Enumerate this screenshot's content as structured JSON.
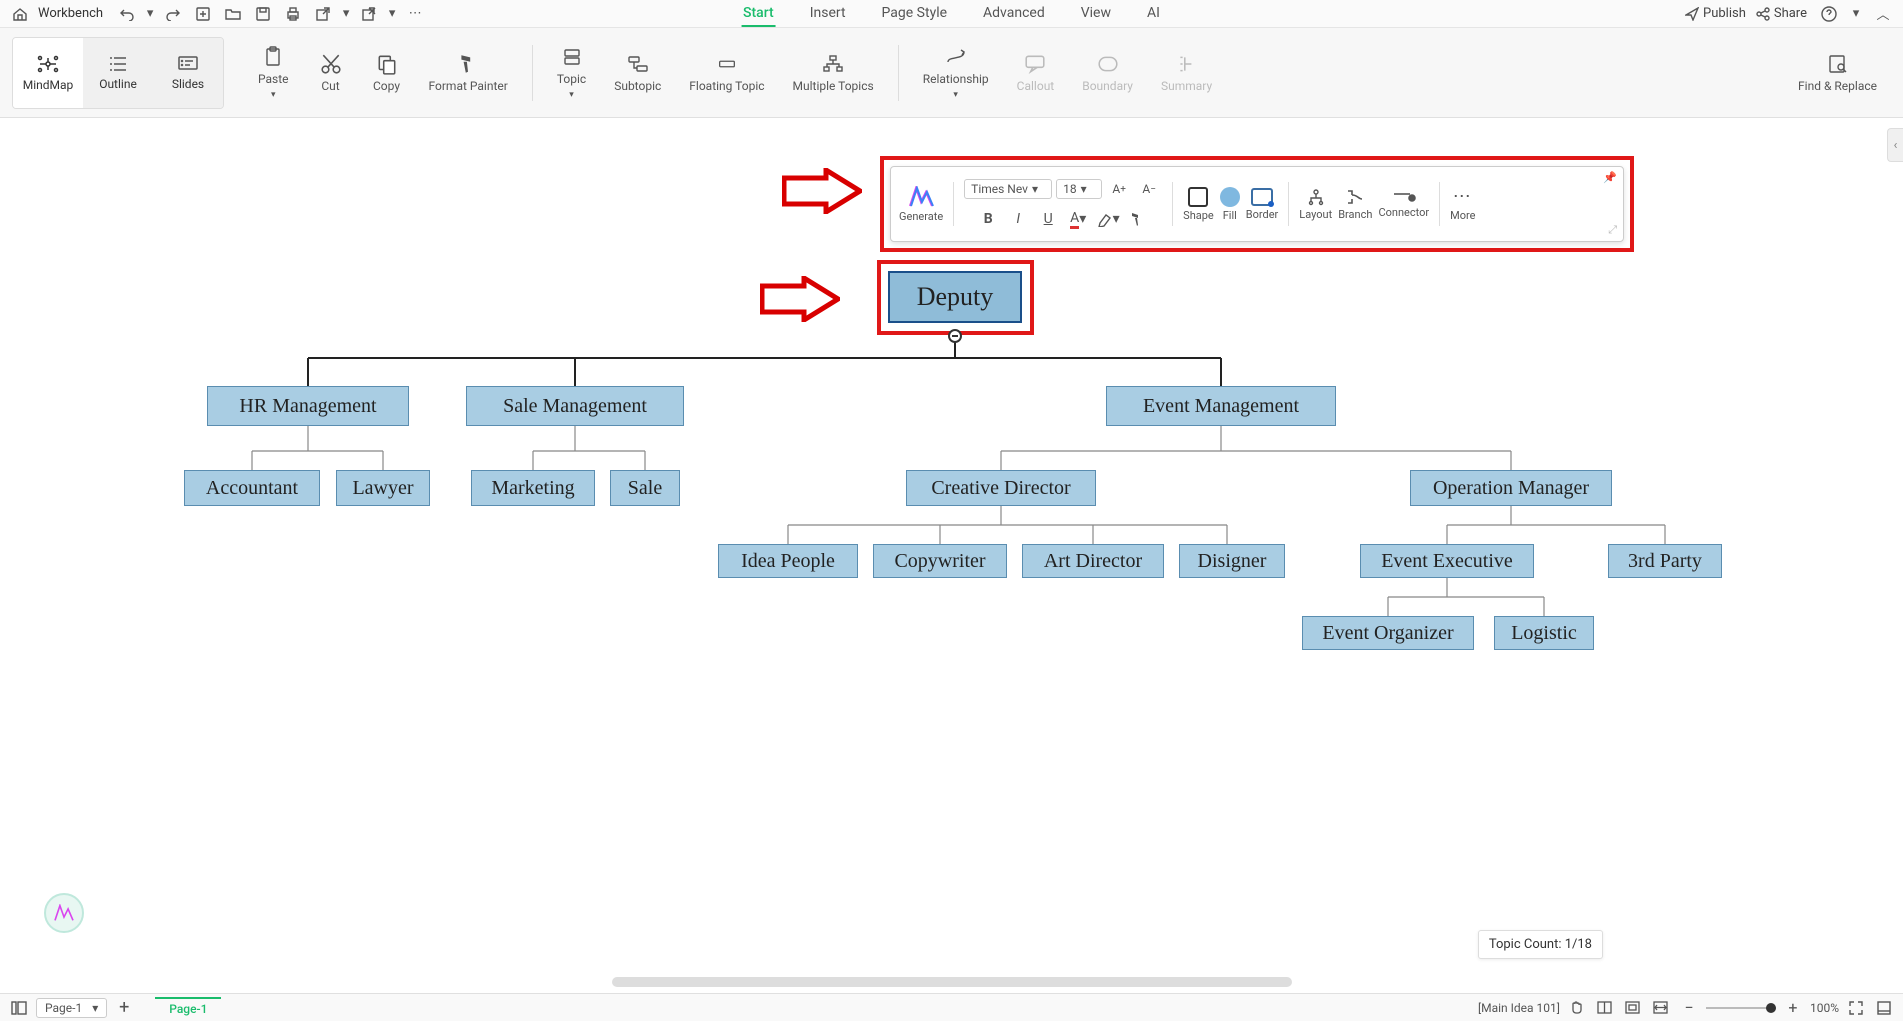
{
  "topbar": {
    "workbench": "Workbench",
    "tabs": [
      "Start",
      "Insert",
      "Page Style",
      "Advanced",
      "View",
      "AI"
    ],
    "active_tab": 0,
    "publish": "Publish",
    "share": "Share"
  },
  "ribbon": {
    "views": [
      "MindMap",
      "Outline",
      "Slides"
    ],
    "active_view": 0,
    "buttons": {
      "paste": "Paste",
      "cut": "Cut",
      "copy": "Copy",
      "format_painter": "Format Painter",
      "topic": "Topic",
      "subtopic": "Subtopic",
      "floating_topic": "Floating Topic",
      "multiple_topics": "Multiple Topics",
      "relationship": "Relationship",
      "callout": "Callout",
      "boundary": "Boundary",
      "summary": "Summary",
      "find_replace": "Find & Replace"
    }
  },
  "minibar": {
    "generate": "Generate",
    "font": "Times Nev",
    "size": "18",
    "shape": "Shape",
    "fill": "Fill",
    "border": "Border",
    "layout": "Layout",
    "branch": "Branch",
    "connector": "Connector",
    "more": "More"
  },
  "chart_data": {
    "type": "tree",
    "root": {
      "label": "Deputy",
      "children": [
        {
          "label": "HR Management",
          "children": [
            {
              "label": "Accountant"
            },
            {
              "label": "Lawyer"
            }
          ]
        },
        {
          "label": "Sale Management",
          "children": [
            {
              "label": "Marketing"
            },
            {
              "label": "Sale"
            }
          ]
        },
        {
          "label": "Event Management",
          "children": [
            {
              "label": "Creative Director",
              "children": [
                {
                  "label": "Idea People"
                },
                {
                  "label": "Copywriter"
                },
                {
                  "label": "Art Director"
                },
                {
                  "label": "Disigner"
                }
              ]
            },
            {
              "label": "Operation Manager",
              "children": [
                {
                  "label": "Event Executive",
                  "children": [
                    {
                      "label": "Event Organizer"
                    },
                    {
                      "label": "Logistic"
                    }
                  ]
                },
                {
                  "label": "3rd Party"
                }
              ]
            }
          ]
        }
      ]
    }
  },
  "nodes": {
    "deputy": "Deputy",
    "hr": "HR Management",
    "sale_mgmt": "Sale Management",
    "event_mgmt": "Event Management",
    "accountant": "Accountant",
    "lawyer": "Lawyer",
    "marketing": "Marketing",
    "sale": "Sale",
    "creative": "Creative Director",
    "operation": "Operation Manager",
    "idea": "Idea People",
    "copy": "Copywriter",
    "art": "Art Director",
    "disigner": "Disigner",
    "event_exec": "Event Executive",
    "third": "3rd Party",
    "event_org": "Event Organizer",
    "logistic": "Logistic"
  },
  "status": {
    "page_selector": "Page-1",
    "page_tab": "Page-1",
    "main_idea": "[Main Idea 101]",
    "topic_count": "Topic Count: 1/18",
    "zoom": "100%"
  }
}
